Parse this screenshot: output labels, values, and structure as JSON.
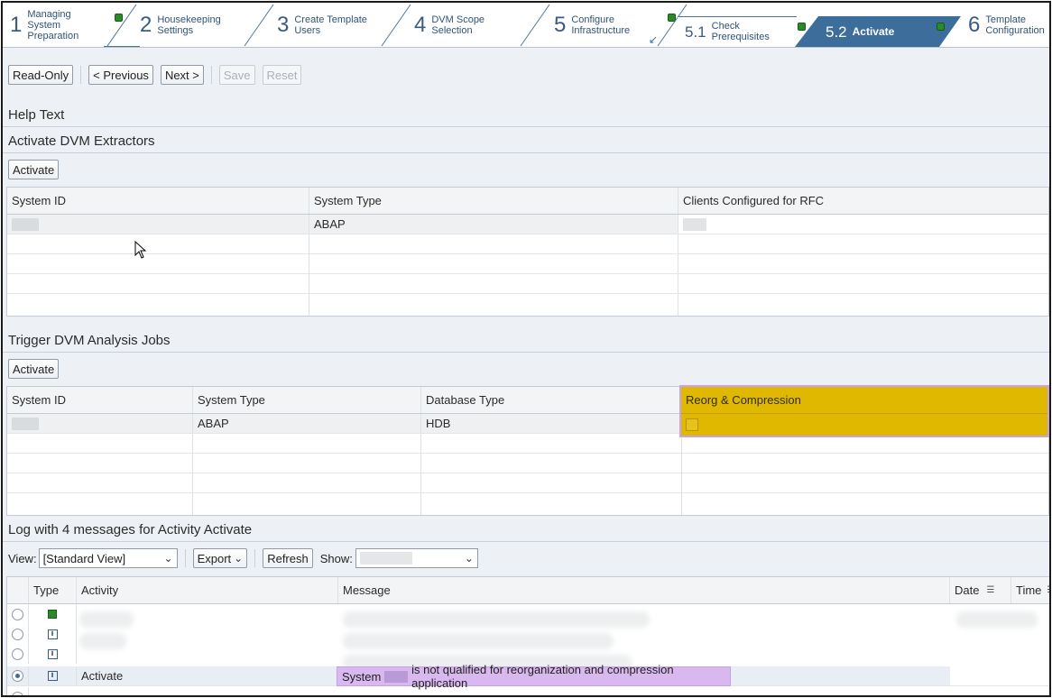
{
  "roadmap": {
    "steps": [
      {
        "num": "1",
        "label": "Managing\nSystem\nPreparation"
      },
      {
        "num": "2",
        "label": "Housekeeping\nSettings"
      },
      {
        "num": "3",
        "label": "Create Template\nUsers"
      },
      {
        "num": "4",
        "label": "DVM Scope\nSelection"
      },
      {
        "num": "5",
        "label": "Configure\nInfrastructure"
      },
      {
        "num": "5.1",
        "label": "Check\nPrerequisites"
      },
      {
        "num": "5.2",
        "label": "Activate"
      },
      {
        "num": "6",
        "label": "Template\nConfiguration"
      }
    ],
    "status_color": "#2a8a2a",
    "active_color": "#3d6e9b"
  },
  "toolbar": {
    "read_only": "Read-Only",
    "previous": "< Previous",
    "next": "Next >",
    "save": "Save",
    "reset": "Reset"
  },
  "help_text": "Help Text",
  "extractors": {
    "title": "Activate DVM Extractors",
    "activate": "Activate",
    "columns": [
      "System ID",
      "System Type",
      "Clients Configured for RFC"
    ],
    "rows": [
      {
        "system_type": "ABAP"
      }
    ]
  },
  "analysis": {
    "title": "Trigger DVM Analysis Jobs",
    "activate": "Activate",
    "columns": [
      "System ID",
      "System Type",
      "Database Type",
      "Reorg & Compression"
    ],
    "rows": [
      {
        "system_type": "ABAP",
        "database_type": "HDB"
      }
    ],
    "highlight_color": "#e0b800"
  },
  "log": {
    "title": "Log with 4 messages for Activity Activate",
    "view_label": "View:",
    "view_value": "[Standard View]",
    "export": "Export",
    "refresh": "Refresh",
    "show_label": "Show:",
    "columns": [
      "Type",
      "Activity",
      "Message",
      "Date",
      "Time"
    ],
    "last_row": {
      "activity": "Activate",
      "message_prefix": "System",
      "message_suffix": "is not qualified for reorganization and compression application"
    }
  }
}
